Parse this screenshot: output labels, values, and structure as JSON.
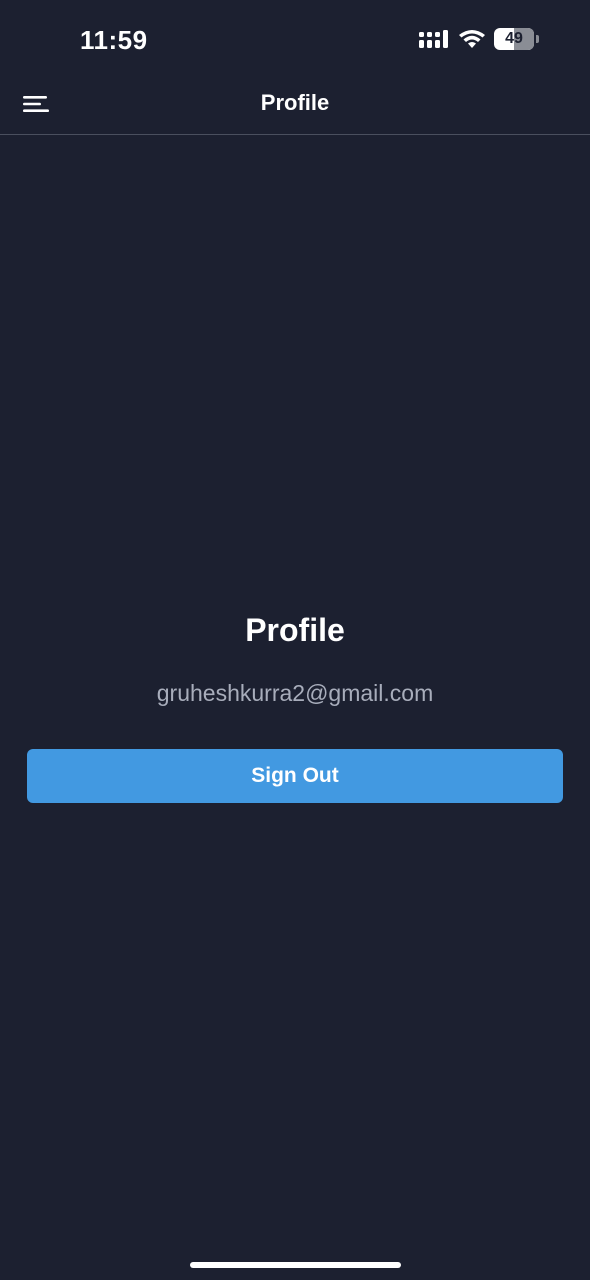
{
  "status_bar": {
    "time": "11:59",
    "battery_level": "49",
    "icons": [
      "signal-icon",
      "wifi-icon",
      "battery-icon"
    ]
  },
  "nav": {
    "title": "Profile",
    "menu_icon": "hamburger-menu-icon"
  },
  "profile": {
    "heading": "Profile",
    "email": "gruheshkurra2@gmail.com",
    "sign_out_label": "Sign Out"
  },
  "colors": {
    "background": "#1c2030",
    "accent": "#4299e1",
    "secondary_text": "#a8adbb"
  }
}
